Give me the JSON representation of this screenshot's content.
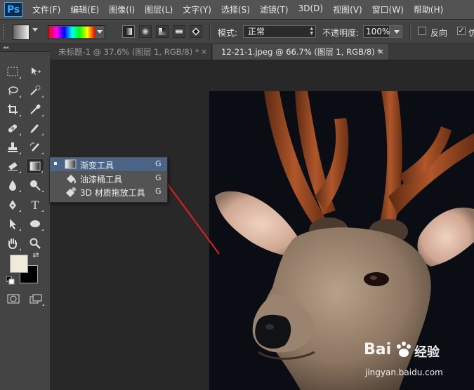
{
  "app": {
    "logo": "Ps"
  },
  "menu": [
    "文件(F)",
    "编辑(E)",
    "图像(I)",
    "图层(L)",
    "文字(Y)",
    "选择(S)",
    "滤镜(T)",
    "3D(D)",
    "视图(V)",
    "窗口(W)",
    "帮助(H)"
  ],
  "options_bar": {
    "gradient_types": [
      "linear",
      "radial",
      "angle",
      "reflected",
      "diamond"
    ],
    "mode_label": "模式:",
    "mode_value": "正常",
    "opacity_label": "不透明度:",
    "opacity_value": "100%",
    "reverse_label": "反向",
    "reverse_checked": false,
    "dither_checked": true,
    "dither_label": "仿"
  },
  "toolbar": {
    "collapse_glyph": "◂◂",
    "text_tool_glyph": "T",
    "foreground_color": "#efebdb",
    "background_color": "#000000"
  },
  "tabs": [
    {
      "label": "未标题-1 @ 37.6% (图层 1, RGB/8) *",
      "active": false,
      "close": "×"
    },
    {
      "label": "12-21-1.jpeg @ 66.7% (图层 1, RGB/8) *",
      "active": true,
      "close": "×"
    }
  ],
  "flyout": {
    "items": [
      {
        "label": "渐变工具",
        "shortcut": "G",
        "icon": "gradient-icon",
        "selected": true
      },
      {
        "label": "油漆桶工具",
        "shortcut": "G",
        "icon": "paint-bucket-icon",
        "selected": false
      },
      {
        "label": "3D 材质拖放工具",
        "shortcut": "G",
        "icon": "3d-material-drop-icon",
        "selected": false
      }
    ]
  },
  "watermark": {
    "brand": "Bai",
    "brand_suffix": "经验",
    "url": "jingyan.baidu.com"
  },
  "colors": {
    "menubar": "#535353",
    "panel": "#444444",
    "selection": "#4a6487",
    "arrow": "#e02020"
  }
}
